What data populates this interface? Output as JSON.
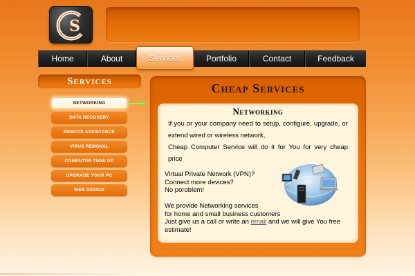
{
  "logo": {
    "icon": "cs-logo-icon"
  },
  "nav": {
    "items": [
      {
        "label": "Home"
      },
      {
        "label": "About"
      },
      {
        "label": "Services",
        "active": true
      },
      {
        "label": "Portfolio"
      },
      {
        "label": "Contact"
      },
      {
        "label": "Feedback"
      }
    ]
  },
  "sidebar": {
    "title": "Services",
    "items": [
      {
        "label": "NETWORKING",
        "active": true
      },
      {
        "label": "DATA RECOVERY"
      },
      {
        "label": "REMOTE ASSISTANCE"
      },
      {
        "label": "VIRUS REMOVAL"
      },
      {
        "label": "COMPUTER TUNE UP"
      },
      {
        "label": "UPGRADE YOUR PC"
      },
      {
        "label": "WEB DESIGN"
      }
    ]
  },
  "main": {
    "title": "Cheap Services",
    "section_title": "Networking",
    "para1_line1": "If you or your company need to setup, configure, upgrade, or extend wired or wireless network,",
    "para1_line2": "Cheap Computer Service will do it for You for very cheap price",
    "para2_line1": "Virtual Private Network (VPN)?",
    "para2_line2": "Connect more devices?",
    "para2_line3": "No poroblem!",
    "para3_line1": "We provide Networking services",
    "para3_line2": "for home and small business customers",
    "para3_line3_pre": "Just give us a call or write an ",
    "para3_link": "email",
    "para3_line3_post": " and we will give You free estimate!"
  },
  "colors": {
    "accent": "#e8720a",
    "nav_bg": "#202020",
    "content_bg": "#fff4dc"
  }
}
